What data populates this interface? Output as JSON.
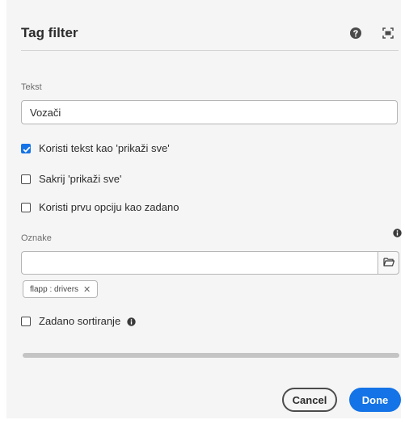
{
  "dialog": {
    "title": "Tag filter",
    "header_icons": [
      "help-icon",
      "fullscreen-icon"
    ]
  },
  "fields": {
    "text_label": "Tekst",
    "text_value": "Vozači",
    "tags_label": "Oznake",
    "tags_input_value": "",
    "tag_chips": [
      {
        "label": "flapp : drivers"
      }
    ]
  },
  "checkboxes": [
    {
      "label": "Koristi tekst kao 'prikaži sve'",
      "checked": true
    },
    {
      "label": "Sakrij 'prikaži sve'",
      "checked": false
    },
    {
      "label": "Koristi prvu opciju kao zadano",
      "checked": false
    },
    {
      "label": "Zadano sortiranje",
      "checked": false
    }
  ],
  "buttons": {
    "cancel": "Cancel",
    "done": "Done"
  },
  "colors": {
    "accent": "#1473e6",
    "background": "#f5f5f5"
  }
}
